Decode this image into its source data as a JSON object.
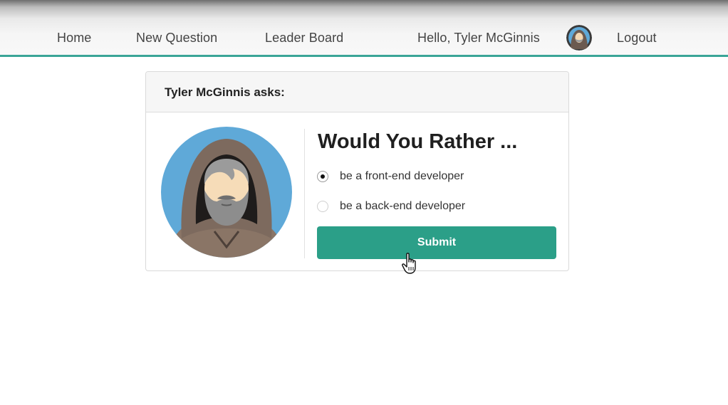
{
  "nav": {
    "home": "Home",
    "new_question": "New Question",
    "leader_board": "Leader Board",
    "greeting": "Hello, Tyler McGinnis",
    "logout": "Logout"
  },
  "card": {
    "header": "Tyler McGinnis asks:",
    "title": "Would You Rather ...",
    "options": [
      {
        "label": "be a front-end developer",
        "checked": true
      },
      {
        "label": "be a back-end developer",
        "checked": false
      }
    ],
    "submit_label": "Submit"
  },
  "colors": {
    "accent": "#2b9f88",
    "nav_border": "#3aa597",
    "avatar_bg": "#5fa9d8",
    "hood": "#7d6a5e"
  },
  "icons": {
    "user_avatar": "user-avatar-icon",
    "card_avatar": "hooded-man-avatar",
    "cursor": "hand-pointer-icon"
  }
}
